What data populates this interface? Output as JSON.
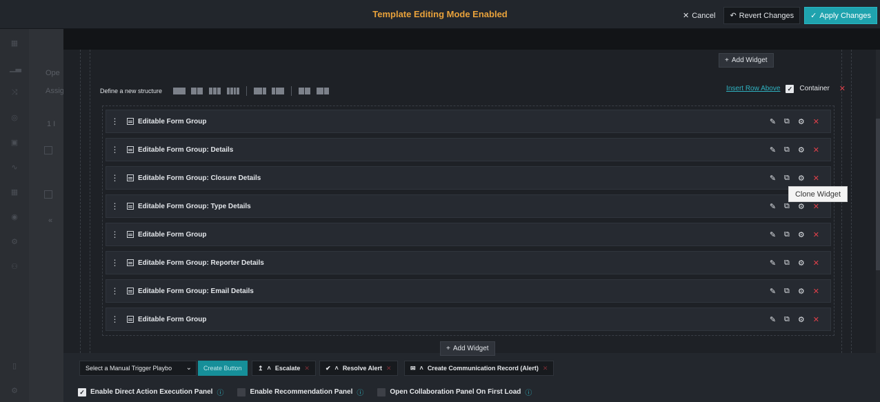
{
  "topbar": {
    "title": "Template Editing Mode Enabled",
    "cancel_label": "Cancel",
    "revert_label": "Revert Changes",
    "apply_label": "Apply Changes"
  },
  "subpanel": {
    "text1": "Ope",
    "text2": "Assig",
    "text3": "1 I",
    "collapse": "«"
  },
  "editor": {
    "add_widget_top": "Add Widget",
    "add_widget_bottom": "Add Widget",
    "structure_label": "Define a new structure",
    "insert_row_above": "Insert Row Above",
    "container_label": "Container",
    "rows": [
      {
        "label": "Editable Form Group"
      },
      {
        "label": "Editable Form Group: Details"
      },
      {
        "label": "Editable Form Group: Closure Details"
      },
      {
        "label": "Editable Form Group: Type Details"
      },
      {
        "label": "Editable Form Group"
      },
      {
        "label": "Editable Form Group: Reporter Details"
      },
      {
        "label": "Editable Form Group: Email Details"
      },
      {
        "label": "Editable Form Group"
      }
    ],
    "tooltip": "Clone Widget"
  },
  "bottom": {
    "trigger_select_value": "Select a Manual Trigger Playbo",
    "create_button": "Create Button",
    "actions": [
      {
        "label": "Escalate"
      },
      {
        "label": "Resolve Alert"
      },
      {
        "label": "Create Communication Record (Alert)"
      }
    ],
    "options": [
      {
        "label": "Enable Direct Action Execution Panel",
        "checked": true
      },
      {
        "label": "Enable Recommendation Panel",
        "checked": false
      },
      {
        "label": "Open Collaboration Panel On First Load",
        "checked": false
      }
    ]
  },
  "colors": {
    "accent": "#1fa3ae",
    "title": "#e9a23b",
    "danger": "#e0404a"
  }
}
